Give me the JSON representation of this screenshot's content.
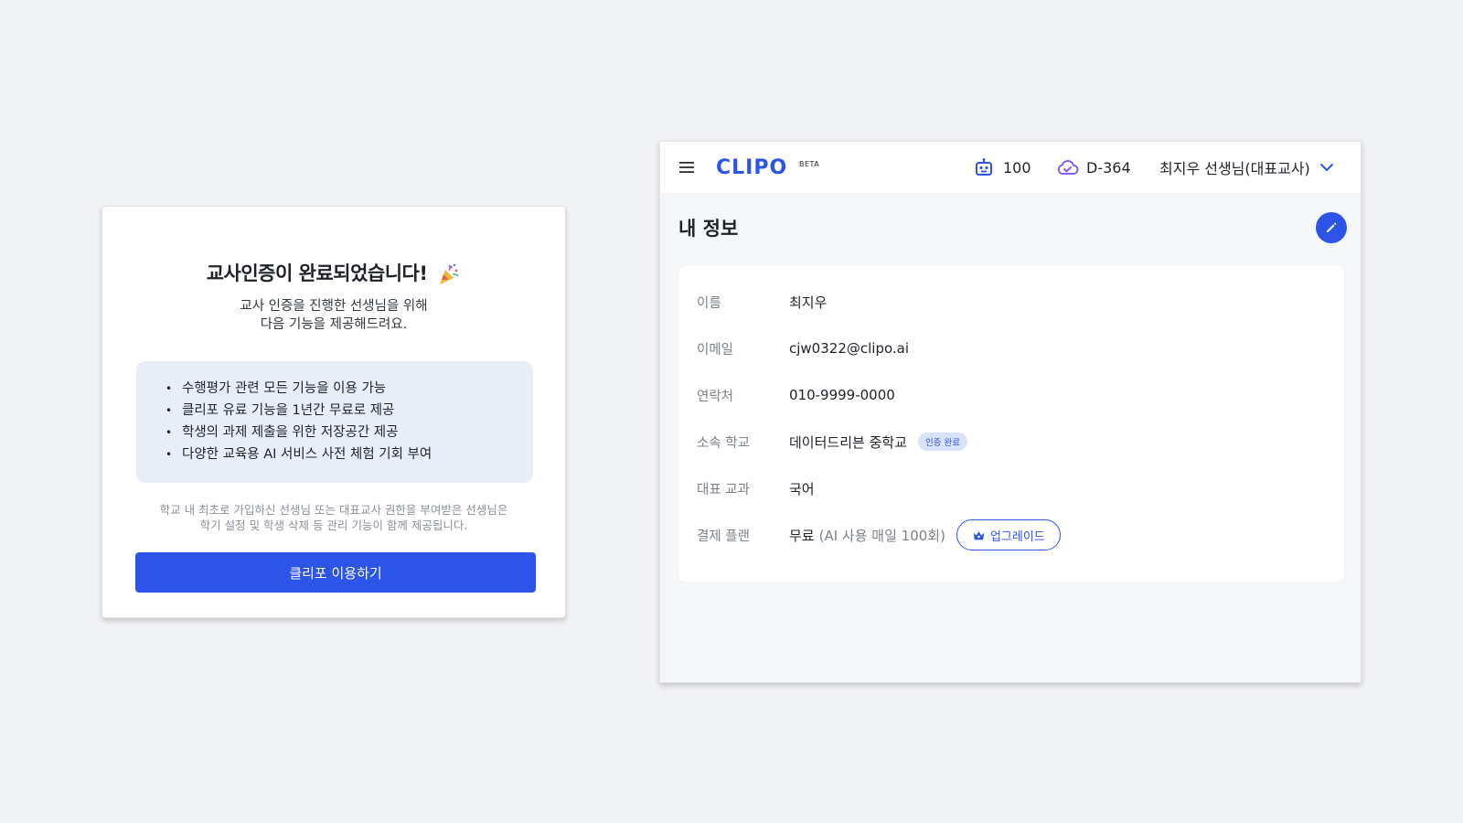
{
  "modal": {
    "title": "교사인증이 완료되었습니다!",
    "subtitle_line1": "교사 인증을 진행한 선생님을 위해",
    "subtitle_line2": "다음 기능을 제공해드려요.",
    "features": [
      "수행평가 관련 모든 기능을 이용 가능",
      "클리포 유료 기능을 1년간 무료로 제공",
      "학생의 과제 제출을 위한 저장공간 제공",
      "다양한 교육용 AI 서비스 사전 체험 기회 부여"
    ],
    "note_line1": "학교 내 최초로 가입하신 선생님 또는 대표교사 권한을 부여받은 선생님은",
    "note_line2": "학기 설정 및 학생 삭제 등 관리 기능이 함께 제공됩니다.",
    "cta_label": "클리포 이용하기"
  },
  "app": {
    "logo_text": "CLIPO",
    "logo_badge": "BETA",
    "credits": "100",
    "dday": "D-364",
    "user_label": "최지우 선생님(대표교사)",
    "page_title": "내 정보",
    "fields": {
      "name_label": "이름",
      "name_value": "최지우",
      "email_label": "이메일",
      "email_value": "cjw0322@clipo.ai",
      "phone_label": "연락처",
      "phone_value": "010-9999-0000",
      "school_label": "소속 학교",
      "school_value": "데이터드리븐 중학교",
      "school_badge": "인증 완료",
      "subject_label": "대표 교과",
      "subject_value": "국어",
      "plan_label": "결제 플랜",
      "plan_value": "무료",
      "plan_detail": "(AI 사용 매일 100회)",
      "upgrade_label": "업그레이드"
    },
    "colors": {
      "accent": "#2c55e8",
      "cloud_icon": "#8a5cf6",
      "badge_bg": "#d8e2fb"
    }
  },
  "icons": {
    "menu": "hamburger-menu-icon",
    "credits": "robot-icon",
    "dday": "cloud-check-icon",
    "user": "chevron-down-icon",
    "edit": "pencil-icon",
    "upgrade": "crown-icon",
    "title": "party-popper-icon"
  }
}
